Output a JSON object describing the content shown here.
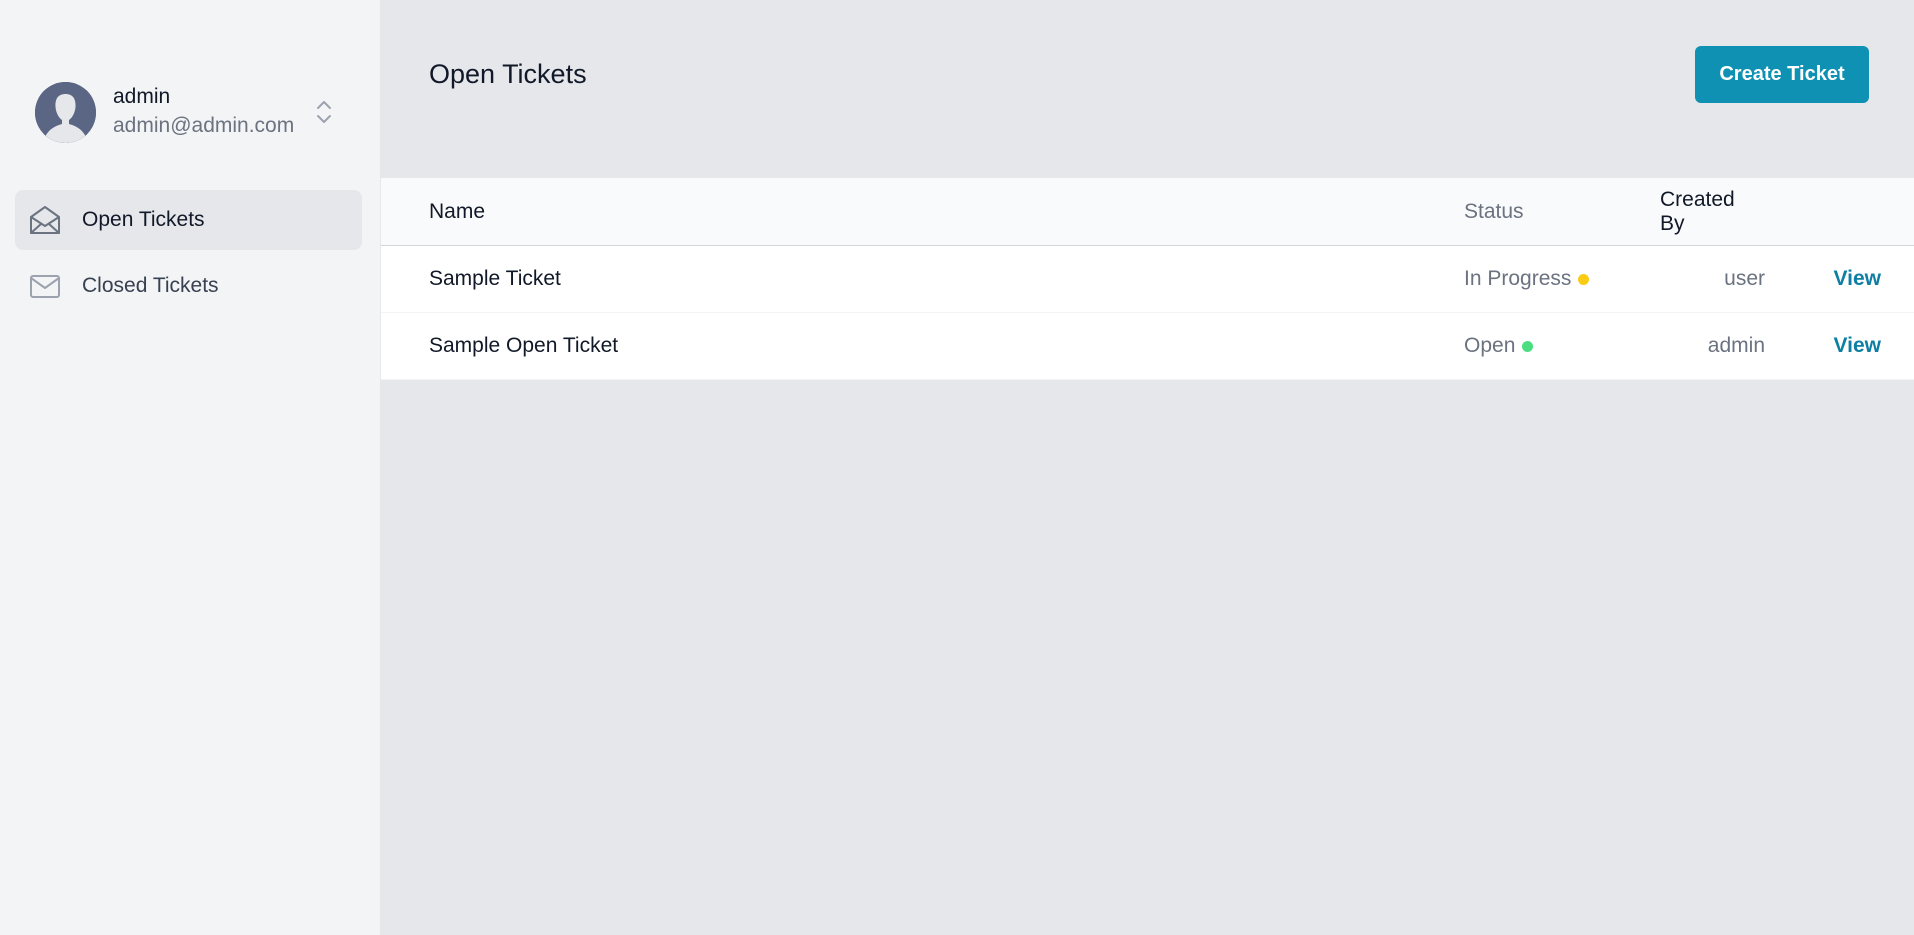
{
  "user": {
    "name": "admin",
    "email": "admin@admin.com"
  },
  "nav": {
    "items": [
      {
        "label": "Open Tickets",
        "icon": "envelope-open-icon",
        "active": true
      },
      {
        "label": "Closed Tickets",
        "icon": "envelope-icon",
        "active": false
      }
    ]
  },
  "page": {
    "title": "Open Tickets",
    "create_button": "Create Ticket"
  },
  "table": {
    "headers": {
      "name": "Name",
      "status": "Status",
      "created_by": "Created By"
    },
    "rows": [
      {
        "name": "Sample Ticket",
        "status": "In Progress",
        "status_color": "#facc15",
        "created_by": "user",
        "action": "View"
      },
      {
        "name": "Sample Open Ticket",
        "status": "Open",
        "status_color": "#4ade80",
        "created_by": "admin",
        "action": "View"
      }
    ]
  },
  "colors": {
    "accent": "#0e91b3",
    "link": "#0e7fa3",
    "sidebar_bg": "#f3f4f6",
    "main_bg": "#e5e7eb"
  }
}
